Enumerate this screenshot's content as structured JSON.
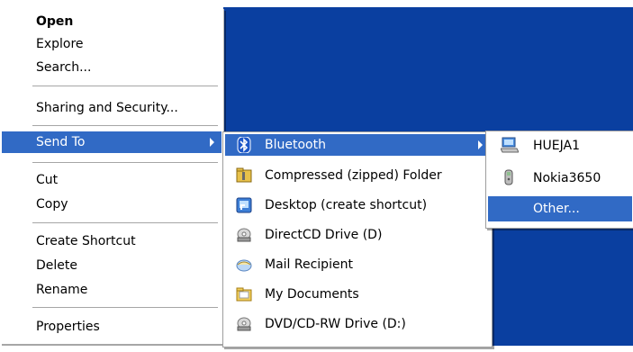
{
  "context_menu": {
    "items": [
      {
        "label": "Open"
      },
      {
        "label": "Explore"
      },
      {
        "label": "Search..."
      },
      {
        "label": "Sharing and Security..."
      },
      {
        "label": "Send To"
      },
      {
        "label": "Cut"
      },
      {
        "label": "Copy"
      },
      {
        "label": "Create Shortcut"
      },
      {
        "label": "Delete"
      },
      {
        "label": "Rename"
      },
      {
        "label": "Properties"
      }
    ]
  },
  "send_to_menu": {
    "items": [
      {
        "label": "Bluetooth",
        "icon": "bluetooth-icon"
      },
      {
        "label": "Compressed (zipped) Folder",
        "icon": "zip-folder-icon"
      },
      {
        "label": "Desktop (create shortcut)",
        "icon": "desktop-shortcut-icon"
      },
      {
        "label": "DirectCD Drive (D)",
        "icon": "cd-drive-icon"
      },
      {
        "label": "Mail Recipient",
        "icon": "mail-icon"
      },
      {
        "label": "My Documents",
        "icon": "folder-icon"
      },
      {
        "label": "DVD/CD-RW Drive (D:)",
        "icon": "dvd-drive-icon"
      }
    ]
  },
  "bluetooth_menu": {
    "items": [
      {
        "label": "HUEJA1",
        "icon": "computer-icon"
      },
      {
        "label": "Nokia3650",
        "icon": "phone-icon"
      },
      {
        "label": "Other..."
      }
    ]
  },
  "colors": {
    "desktop_blue": "#0a3fa0",
    "highlight": "#316ac5"
  }
}
